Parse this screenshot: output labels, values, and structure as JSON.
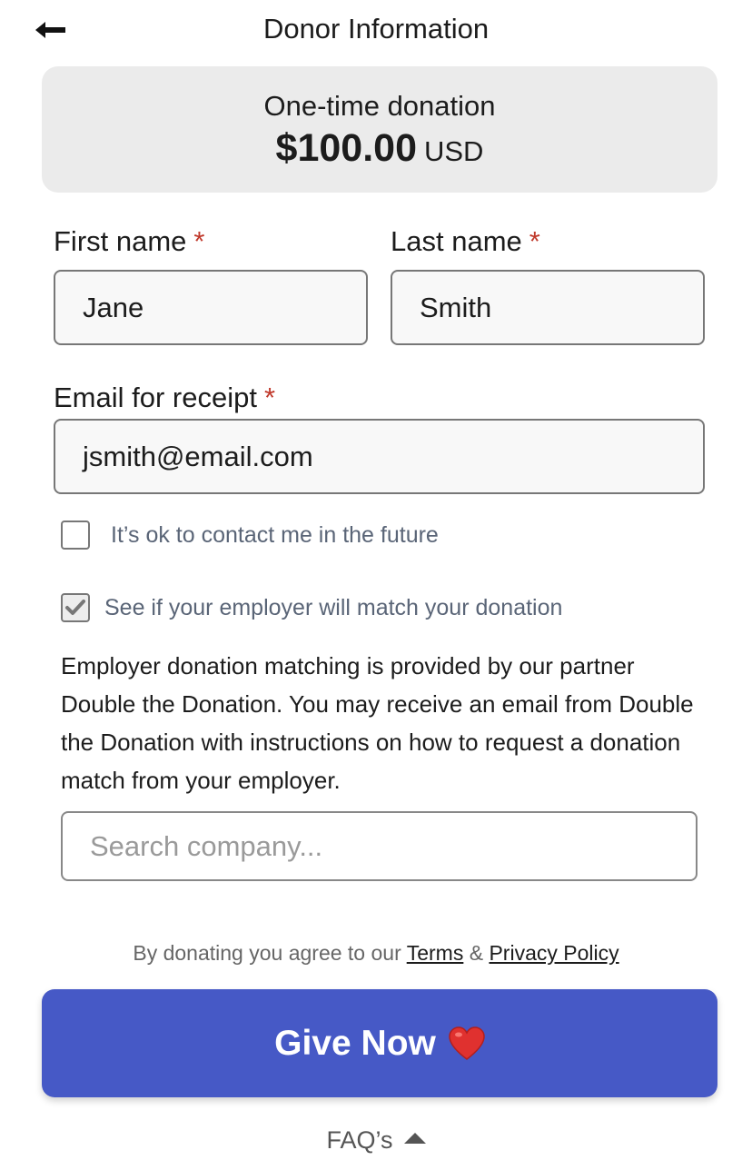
{
  "header": {
    "title": "Donor Information",
    "back_icon": "arrow-left-icon"
  },
  "summary": {
    "type": "One-time donation",
    "amount": "$100.00",
    "currency": "USD"
  },
  "form": {
    "first_name": {
      "label": "First name",
      "required_mark": "*",
      "value": "Jane"
    },
    "last_name": {
      "label": "Last name",
      "required_mark": "*",
      "value": "Smith"
    },
    "email": {
      "label": "Email for receipt",
      "required_mark": "*",
      "value": "jsmith@email.com"
    },
    "contact_optin": {
      "label": "It’s ok to contact me in the future",
      "checked": false
    },
    "employer_match": {
      "label": "See if your employer will match your donation",
      "checked": true
    },
    "match_info": "Employer donation matching is provided by our partner Double the Donation. You may receive an email from Double the Donation with instructions on how to request a donation match from your employer.",
    "company_search": {
      "placeholder": "Search company...",
      "value": ""
    }
  },
  "legal": {
    "prefix": "By donating you agree to our",
    "terms": "Terms",
    "amp": "&",
    "privacy": "Privacy Policy"
  },
  "cta": {
    "label": "Give Now",
    "icon": "heart-icon",
    "color": "#4659c6"
  },
  "faq": {
    "label": "FAQ’s",
    "icon": "caret-up-icon"
  }
}
